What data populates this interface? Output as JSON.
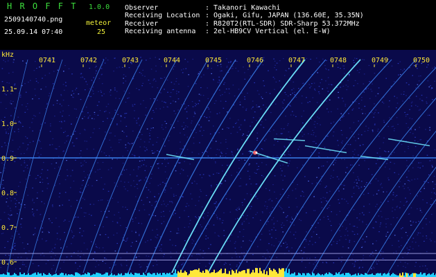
{
  "app": {
    "name": "H R O F F T",
    "version": "1.0.0",
    "filename": "2509140740.png",
    "datetime": "25.09.14 07:40",
    "meteor_label": "meteor",
    "meteor_count": "25"
  },
  "info": {
    "observer_label": "Observer",
    "observer_value": ": Takanori Kawachi",
    "location_label": "Receiving Location",
    "location_value": ": Ogaki, Gifu, JAPAN (136.60E, 35.35N)",
    "receiver_label": "Receiver",
    "receiver_value": ": R820T2(RTL-SDR) SDR-Sharp 53.372MHz",
    "antenna_label": "Receiving antenna",
    "antenna_value": ": 2el-HB9CV Vertical (el. E-W)"
  },
  "spectrogram": {
    "unit_label": "kHz",
    "time_labels": [
      "0741",
      "0742",
      "0743",
      "0744",
      "0745",
      "0746",
      "0747",
      "0748",
      "0749",
      "0750"
    ],
    "freq_labels": [
      "1.1",
      "1.0",
      "0.9",
      "0.8",
      "0.7",
      "0.6"
    ],
    "freq_values": [
      1.1,
      1.0,
      0.9,
      0.8,
      0.7,
      0.6
    ],
    "carrier_khz": 0.9,
    "colors": {
      "background": "#0a0a4a",
      "noise": "#2a3cc8",
      "trace": "#3f8cff",
      "trace_bright": "#6fe8ff",
      "hot": "#ffffff",
      "meteor_hot": "#ff6464",
      "baseline": "#ffe838",
      "cyan_floor": "#20d0ff",
      "label": "#ffe838"
    }
  }
}
